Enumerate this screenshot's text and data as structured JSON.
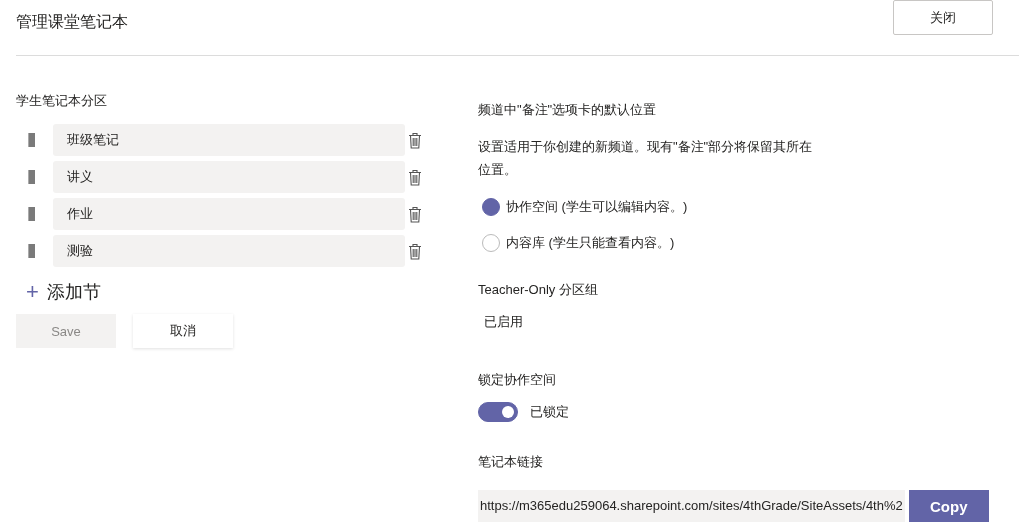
{
  "header": {
    "title": "管理课堂笔记本",
    "close_button": "关闭"
  },
  "sections": {
    "heading": "学生笔记本分区",
    "items": [
      {
        "name": "班级笔记"
      },
      {
        "name": "讲义"
      },
      {
        "name": "作业"
      },
      {
        "name": "测验"
      }
    ],
    "add_label": "添加节",
    "add_icon": "+"
  },
  "actions": [
    {
      "label": "Save",
      "disabled": true
    },
    {
      "label": "取消",
      "disabled": false
    }
  ],
  "notes_tab": {
    "heading": "频道中\"备注\"选项卡的默认位置",
    "description": "设置适用于你创建的新频道。现有\"备注\"部分将保留其所在位置。",
    "options": [
      {
        "label": "协作空间 (学生可以编辑内容。)",
        "selected": true
      },
      {
        "label": "内容库 (学生只能查看内容。)",
        "selected": false
      }
    ]
  },
  "teacher_only": {
    "heading": "Teacher-Only 分区组",
    "status": "已启用"
  },
  "lock": {
    "heading": "锁定协作空间",
    "on": true,
    "label": "已锁定"
  },
  "link": {
    "heading": "笔记本链接",
    "url": "https://m365edu259064.sharepoint.com/sites/4thGrade/SiteAssets/4th%2",
    "copy_button": "Copy"
  }
}
